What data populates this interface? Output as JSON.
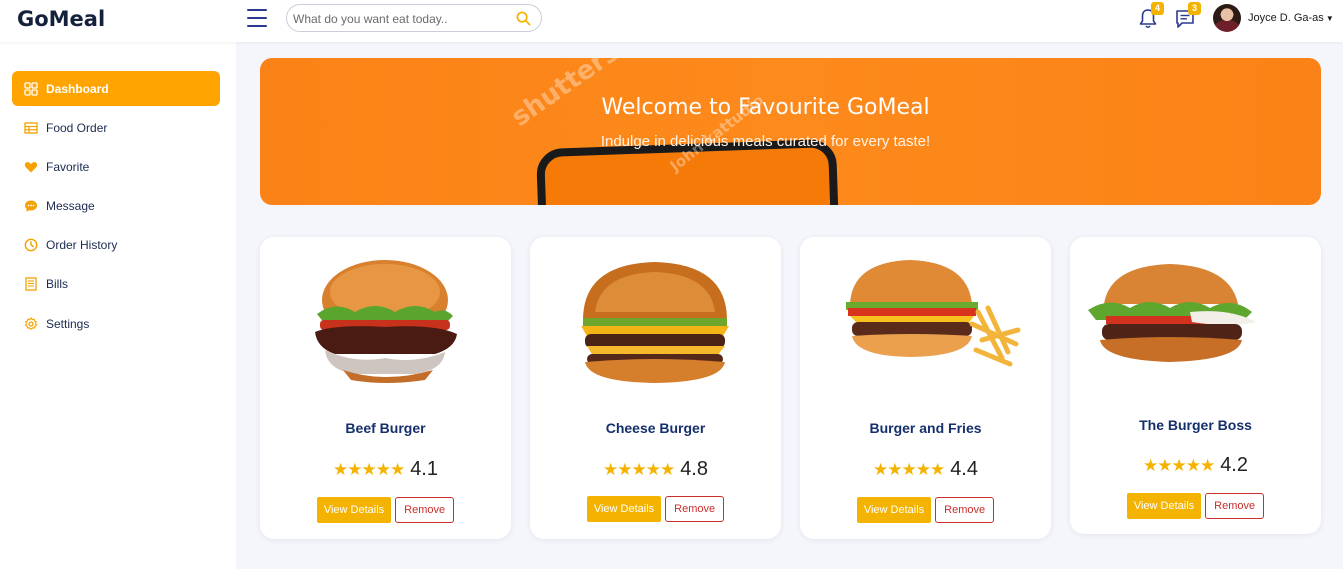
{
  "app": {
    "logo": "GoMeal"
  },
  "search": {
    "placeholder": "What do you want eat today.."
  },
  "header": {
    "notifications_count": "4",
    "messages_count": "3",
    "username": "Joyce D. Ga-as"
  },
  "sidebar": {
    "items": [
      {
        "label": "Dashboard",
        "icon": "grid-icon",
        "active": true
      },
      {
        "label": "Food Order",
        "icon": "table-icon"
      },
      {
        "label": "Favorite",
        "icon": "heart-icon"
      },
      {
        "label": "Message",
        "icon": "chat-icon"
      },
      {
        "label": "Order History",
        "icon": "clock-icon"
      },
      {
        "label": "Bills",
        "icon": "receipt-icon"
      },
      {
        "label": "Settings",
        "icon": "gear-icon"
      }
    ]
  },
  "hero": {
    "title": "Welcome to Favourite GoMeal",
    "subtitle": "Indulge in delicious meals curated for every taste!",
    "watermark": "shutterstock",
    "watermark2": "John kattudio"
  },
  "cards": [
    {
      "name": "Beef Burger",
      "stars": "★★★★★",
      "rating": "4.1",
      "view_label": "View Details",
      "remove_label": "Remove"
    },
    {
      "name": "Cheese Burger",
      "stars": "★★★★★",
      "rating": "4.8",
      "view_label": "View Details",
      "remove_label": "Remove"
    },
    {
      "name": "Burger and Fries",
      "stars": "★★★★★",
      "rating": "4.4",
      "view_label": "View Details",
      "remove_label": "Remove"
    },
    {
      "name": "The Burger Boss",
      "stars": "★★★★★",
      "rating": "4.2",
      "view_label": "View Details",
      "remove_label": "Remove"
    }
  ],
  "colors": {
    "accent": "#ffa400",
    "button": "#f5b301",
    "hero": "#fb8216",
    "remove": "#c9302c",
    "nav_text": "#1a2a52"
  }
}
